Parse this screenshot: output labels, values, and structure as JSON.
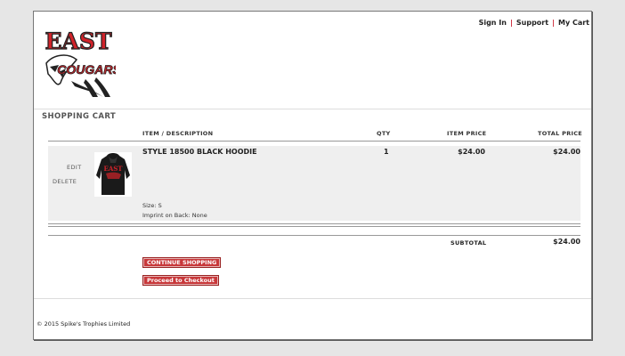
{
  "nav": {
    "sign_in": "Sign In",
    "sep1": "|",
    "support": "Support",
    "sep2": "|",
    "my_cart": "My Cart"
  },
  "logo": {
    "top_text": "EAST",
    "bottom_text": "COUGARS"
  },
  "section_title": "SHOPPING CART",
  "columns": {
    "item": "ITEM / DESCRIPTION",
    "qty": "QTY",
    "item_price": "ITEM PRICE",
    "total_price": "TOTAL PRICE"
  },
  "cart_item": {
    "edit": "EDIT",
    "delete": "DELETE",
    "thumb_text": "EAST",
    "name": "STYLE 18500 BLACK HOODIE",
    "qty": "1",
    "item_price": "$24.00",
    "total_price": "$24.00",
    "size": "Size: S",
    "imprint": "Imprint on Back: None"
  },
  "subtotal": {
    "label": "SUBTOTAL",
    "value": "$24.00"
  },
  "buttons": {
    "continue": "CONTINUE SHOPPING",
    "checkout": "Proceed to Checkout"
  },
  "footer": "© 2015  Spike's Trophies Limited",
  "colors": {
    "accent": "#c8383a",
    "logo_red": "#d0232a"
  }
}
